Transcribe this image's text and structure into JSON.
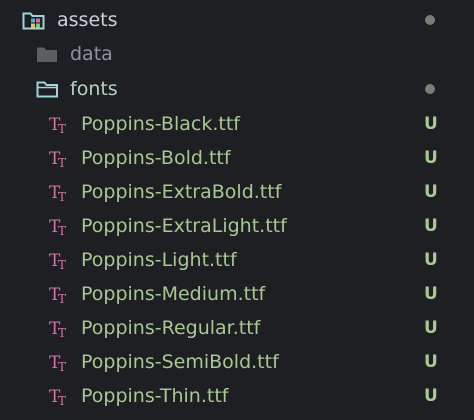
{
  "tree": {
    "root": {
      "label": "assets",
      "icon": "assets-folder-icon",
      "status": "modified-dot"
    },
    "children": [
      {
        "label": "data",
        "icon": "folder-icon"
      },
      {
        "label": "fonts",
        "icon": "folder-open-icon",
        "status": "modified-dot"
      }
    ],
    "files": [
      {
        "label": "Poppins-Black.ttf",
        "status": "U"
      },
      {
        "label": "Poppins-Bold.ttf",
        "status": "U"
      },
      {
        "label": "Poppins-ExtraBold.ttf",
        "status": "U"
      },
      {
        "label": "Poppins-ExtraLight.ttf",
        "status": "U"
      },
      {
        "label": "Poppins-Light.ttf",
        "status": "U"
      },
      {
        "label": "Poppins-Medium.ttf",
        "status": "U"
      },
      {
        "label": "Poppins-Regular.ttf",
        "status": "U"
      },
      {
        "label": "Poppins-SemiBold.ttf",
        "status": "U"
      },
      {
        "label": "Poppins-Thin.ttf",
        "status": "U"
      }
    ],
    "file_icon": "font-file-icon"
  },
  "colors": {
    "background": "#1e1f22",
    "untracked": "#a6c991",
    "font_icon": "#d6759c",
    "folder_icon": "#9fd4d9",
    "status_dot": "#7b7e78"
  }
}
